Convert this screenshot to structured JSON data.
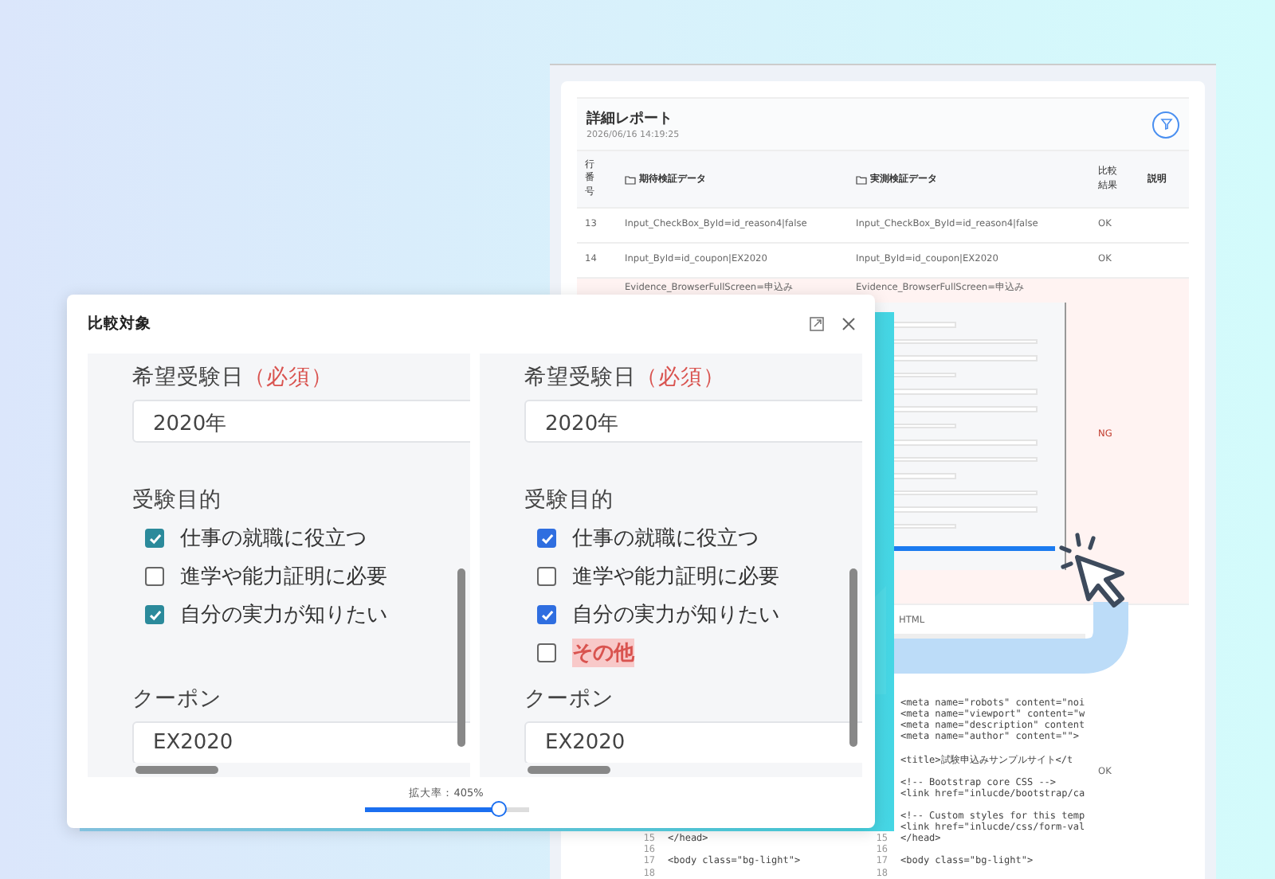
{
  "report": {
    "title": "詳細レポート",
    "timestamp": "2026/06/16 14:19:25",
    "columns": [
      {
        "label": "行番号",
        "kind": "narrow"
      },
      {
        "label": "期待検証データ",
        "kind": "folder"
      },
      {
        "label": "実測検証データ",
        "kind": "folder"
      },
      {
        "label": "比較結果",
        "kind": "narrow"
      },
      {
        "label": "説明",
        "kind": "plain"
      }
    ],
    "rows": [
      {
        "kind": "text",
        "mismatch": false,
        "row_number": "13",
        "expected": "Input_CheckBox_ById=id_reason4|false",
        "actual": "Input_CheckBox_ById=id_reason4|false",
        "result": "OK"
      },
      {
        "kind": "text",
        "mismatch": false,
        "row_number": "14",
        "expected": "Input_ById=id_coupon|EX2020",
        "actual": "Input_ById=id_coupon|EX2020",
        "result": "OK"
      },
      {
        "kind": "screenshot",
        "mismatch": true,
        "expected": "Evidence_BrowserFullScreen=申込み",
        "actual": "Evidence_BrowserFullScreen=申込み",
        "result": "NG"
      },
      {
        "kind": "code",
        "mismatch": false,
        "actual": "HTML",
        "result": "OK",
        "code_lines": [
          {
            "kind": "code",
            "right": "<meta name=\"robots\" content=\"noi"
          },
          {
            "kind": "code",
            "right": "<meta name=\"viewport\" content=\"w"
          },
          {
            "kind": "code",
            "right": "<meta name=\"description\" content"
          },
          {
            "kind": "code",
            "right": "<meta name=\"author\" content=\"\">"
          },
          {
            "kind": "blank"
          },
          {
            "kind": "code",
            "right": "<title>試験申込みサンプルサイト</t"
          },
          {
            "kind": "blank"
          },
          {
            "kind": "code",
            "right": "<!-- Bootstrap core CSS -->"
          },
          {
            "kind": "code",
            "right": "<link href=\"inlucde/bootstrap/ca"
          },
          {
            "kind": "blank"
          },
          {
            "kind": "code",
            "right": "<!-- Custom styles for this temp"
          },
          {
            "kind": "code",
            "right": "<link href=\"inlucde/css/form-val"
          },
          {
            "kind": "code",
            "number": "15",
            "left": "</head>",
            "right_number": "15",
            "right": "</head>"
          },
          {
            "kind": "code",
            "number": "16",
            "right_number": "16"
          },
          {
            "kind": "code",
            "number": "17",
            "left": "<body class=\"bg-light\">",
            "right_number": "17",
            "right": "<body class=\"bg-light\">"
          },
          {
            "kind": "code",
            "number": "18",
            "right_number": "18"
          }
        ]
      }
    ]
  },
  "compare_dialog": {
    "title": "比較対象",
    "panes": [
      {
        "kind": "expected",
        "date_label": "希望受験日",
        "required": "（必須）",
        "date_value": "2020年",
        "purpose_label": "受験目的",
        "options": [
          {
            "label": "仕事の就職に役立つ",
            "checked": true,
            "highlighted": false
          },
          {
            "label": "進学や能力証明に必要",
            "checked": false,
            "highlighted": false
          },
          {
            "label": "自分の実力が知りたい",
            "checked": true,
            "highlighted": false
          }
        ],
        "coupon_label": "クーポン",
        "coupon_value": "EX2020"
      },
      {
        "kind": "actual",
        "date_label": "希望受験日",
        "required": "（必須）",
        "date_value": "2020年",
        "purpose_label": "受験目的",
        "options": [
          {
            "label": "仕事の就職に役立つ",
            "checked": true,
            "highlighted": false
          },
          {
            "label": "進学や能力証明に必要",
            "checked": false,
            "highlighted": false
          },
          {
            "label": "自分の実力が知りたい",
            "checked": true,
            "highlighted": false
          },
          {
            "label": "その他",
            "checked": false,
            "highlighted": true
          }
        ],
        "coupon_label": "クーポン",
        "coupon_value": "EX2020"
      }
    ],
    "zoom": {
      "label": "拡大率：405%",
      "level": 0.82
    }
  }
}
